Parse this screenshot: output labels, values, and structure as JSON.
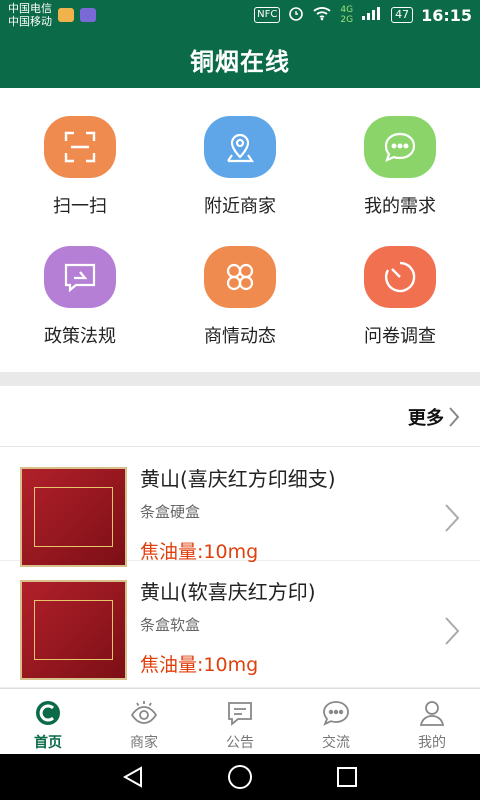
{
  "statusbar": {
    "carrier1": "中国电信",
    "carrier2": "中国移动",
    "nfc": "NFC",
    "network1": "4G",
    "network2": "2G",
    "battery": "47",
    "time": "16:15"
  },
  "appbar": {
    "title": "铜烟在线"
  },
  "grid": [
    {
      "label": "扫一扫",
      "icon": "scan-icon",
      "color": "#f08b4f"
    },
    {
      "label": "附近商家",
      "icon": "location-icon",
      "color": "#5ea6e8"
    },
    {
      "label": "我的需求",
      "icon": "chat-bubble-icon",
      "color": "#8bd46a"
    },
    {
      "label": "政策法规",
      "icon": "share-message-icon",
      "color": "#b57fd6"
    },
    {
      "label": "商情动态",
      "icon": "knot-icon",
      "color": "#f08b4f"
    },
    {
      "label": "问卷调查",
      "icon": "gauge-icon",
      "color": "#f1704f"
    }
  ],
  "more": {
    "label": "更多"
  },
  "products": [
    {
      "name": "黄山(喜庆红方印细支)",
      "package": "条盒硬盒",
      "tar": "焦油量:10mg"
    },
    {
      "name": "黄山(软喜庆红方印)",
      "package": "条盒软盒",
      "tar": "焦油量:10mg"
    }
  ],
  "tabs": [
    {
      "label": "首页",
      "icon": "home-logo-icon",
      "active": true
    },
    {
      "label": "商家",
      "icon": "eye-icon",
      "active": false
    },
    {
      "label": "公告",
      "icon": "notice-icon",
      "active": false
    },
    {
      "label": "交流",
      "icon": "chat-icon",
      "active": false
    },
    {
      "label": "我的",
      "icon": "user-icon",
      "active": false
    }
  ],
  "colors": {
    "primary": "#0b6a47",
    "tar": "#e0400e"
  }
}
